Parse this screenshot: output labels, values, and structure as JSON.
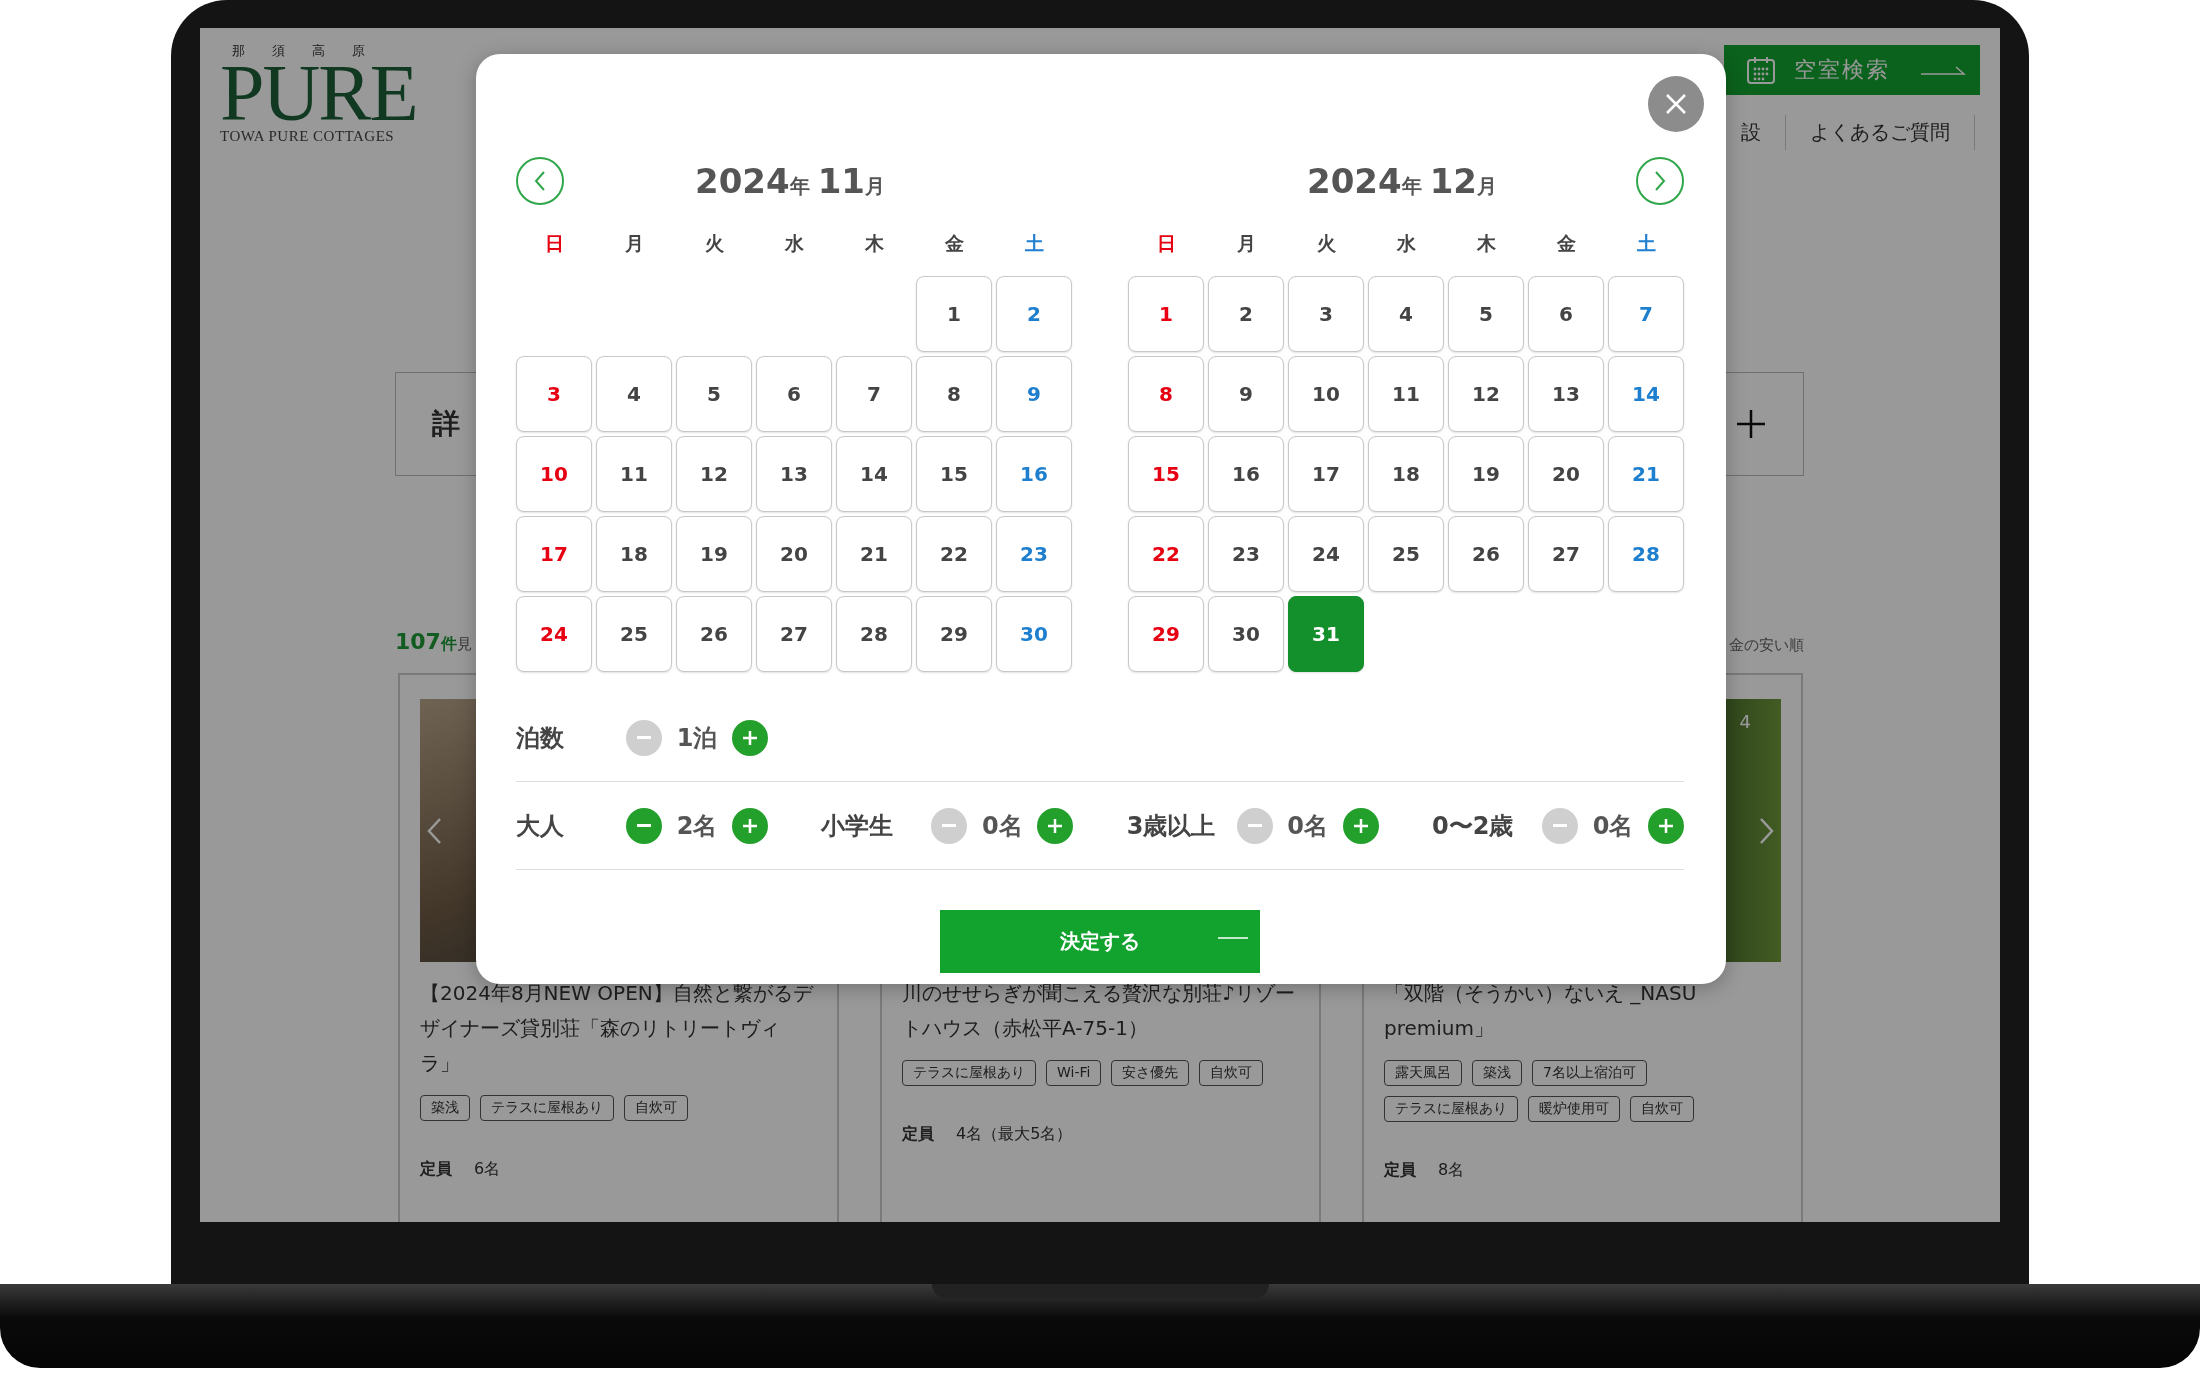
{
  "logo": {
    "subtitle": "那須高原",
    "wordmark": "PURE",
    "tagline": "TOWA PURE COTTAGES"
  },
  "search_button": {
    "label": "空室検索"
  },
  "nav": [
    "設",
    "よくあるご質問"
  ],
  "detail_panel": {
    "label": "詳"
  },
  "results": {
    "count": "107",
    "count_unit": "件",
    "text": "見",
    "sort": "金の安い順"
  },
  "cards": [
    {
      "kind": "room",
      "prev_arrow": true,
      "next_arrow": false,
      "title": "【2024年8月NEW OPEN】自然と繋がるデザイナーズ貸別荘「森のリトリートヴィラ」",
      "tags": [
        "築浅",
        "テラスに屋根あり",
        "自炊可"
      ],
      "capacity_label": "定員",
      "capacity": "6名"
    },
    {
      "kind": "room",
      "title": "川のせせらぎが聞こえる贅沢な別荘♪リゾートハウス（赤松平A-75-1）",
      "tags": [
        "テラスに屋根あり",
        "Wi-Fi",
        "安さ優先",
        "自炊可"
      ],
      "capacity_label": "定員",
      "capacity": "4名（最大5名）"
    },
    {
      "kind": "forest",
      "prev_arrow": false,
      "next_arrow": true,
      "photo_counter": "4",
      "title": "「双階（そうかい）ないえ _NASU premium」",
      "tags": [
        "露天風呂",
        "築浅",
        "7名以上宿泊可",
        "テラスに屋根あり",
        "暖炉使用可",
        "自炊可"
      ],
      "capacity_label": "定員",
      "capacity": "8名"
    }
  ],
  "modal": {
    "calendars": [
      {
        "kind": "prev",
        "year": "2024",
        "year_unit": "年",
        "month": "11",
        "month_unit": "月",
        "weekdays": [
          {
            "label": "日",
            "kind": "sunday"
          },
          {
            "label": "月",
            "kind": "weekday"
          },
          {
            "label": "火",
            "kind": "weekday"
          },
          {
            "label": "水",
            "kind": "weekday"
          },
          {
            "label": "木",
            "kind": "weekday"
          },
          {
            "label": "金",
            "kind": "weekday"
          },
          {
            "label": "土",
            "kind": "saturday"
          }
        ],
        "weeks": [
          [
            {
              "day": "1",
              "selected": false
            },
            {
              "day": "2",
              "selected": false
            }
          ],
          [
            {
              "day": "3",
              "selected": false
            },
            {
              "day": "4",
              "selected": false
            },
            {
              "day": "5",
              "selected": false
            },
            {
              "day": "6",
              "selected": false
            },
            {
              "day": "7",
              "selected": false
            },
            {
              "day": "8",
              "selected": false
            },
            {
              "day": "9",
              "selected": false
            }
          ],
          [
            {
              "day": "10",
              "selected": false
            },
            {
              "day": "11",
              "selected": false
            },
            {
              "day": "12",
              "selected": false
            },
            {
              "day": "13",
              "selected": false
            },
            {
              "day": "14",
              "selected": false
            },
            {
              "day": "15",
              "selected": false
            },
            {
              "day": "16",
              "selected": false
            }
          ],
          [
            {
              "day": "17",
              "selected": false
            },
            {
              "day": "18",
              "selected": false
            },
            {
              "day": "19",
              "selected": false
            },
            {
              "day": "20",
              "selected": false
            },
            {
              "day": "21",
              "selected": false
            },
            {
              "day": "22",
              "selected": false
            },
            {
              "day": "23",
              "selected": false
            }
          ],
          [
            {
              "day": "24",
              "selected": false
            },
            {
              "day": "25",
              "selected": false
            },
            {
              "day": "26",
              "selected": false
            },
            {
              "day": "27",
              "selected": false
            },
            {
              "day": "28",
              "selected": false
            },
            {
              "day": "29",
              "selected": false
            },
            {
              "day": "30",
              "selected": false
            }
          ]
        ]
      },
      {
        "kind": "next",
        "year": "2024",
        "year_unit": "年",
        "month": "12",
        "month_unit": "月",
        "weekdays": [
          {
            "label": "日",
            "kind": "sunday"
          },
          {
            "label": "月",
            "kind": "weekday"
          },
          {
            "label": "火",
            "kind": "weekday"
          },
          {
            "label": "水",
            "kind": "weekday"
          },
          {
            "label": "木",
            "kind": "weekday"
          },
          {
            "label": "金",
            "kind": "weekday"
          },
          {
            "label": "土",
            "kind": "saturday"
          }
        ],
        "weeks": [
          [
            {
              "day": "1",
              "selected": false
            },
            {
              "day": "2",
              "selected": false
            },
            {
              "day": "3",
              "selected": false
            },
            {
              "day": "4",
              "selected": false
            },
            {
              "day": "5",
              "selected": false
            },
            {
              "day": "6",
              "selected": false
            },
            {
              "day": "7",
              "selected": false
            }
          ],
          [
            {
              "day": "8",
              "selected": false
            },
            {
              "day": "9",
              "selected": false
            },
            {
              "day": "10",
              "selected": false
            },
            {
              "day": "11",
              "selected": false
            },
            {
              "day": "12",
              "selected": false
            },
            {
              "day": "13",
              "selected": false
            },
            {
              "day": "14",
              "selected": false
            }
          ],
          [
            {
              "day": "15",
              "selected": false
            },
            {
              "day": "16",
              "selected": false
            },
            {
              "day": "17",
              "selected": false
            },
            {
              "day": "18",
              "selected": false
            },
            {
              "day": "19",
              "selected": false
            },
            {
              "day": "20",
              "selected": false
            },
            {
              "day": "21",
              "selected": false
            }
          ],
          [
            {
              "day": "22",
              "selected": false
            },
            {
              "day": "23",
              "selected": false
            },
            {
              "day": "24",
              "selected": false
            },
            {
              "day": "25",
              "selected": false
            },
            {
              "day": "26",
              "selected": false
            },
            {
              "day": "27",
              "selected": false
            },
            {
              "day": "28",
              "selected": false
            }
          ],
          [
            {
              "day": "29",
              "selected": false
            },
            {
              "day": "30",
              "selected": false
            },
            {
              "day": "31",
              "selected": true
            }
          ]
        ]
      }
    ],
    "counter_rows": [
      [
        {
          "label": "泊数",
          "value": "1泊",
          "minus_disabled": true,
          "plus_disabled": false
        }
      ],
      [
        {
          "label": "大人",
          "value": "2名",
          "minus_disabled": false,
          "plus_disabled": false
        },
        {
          "label": "小学生",
          "value": "0名",
          "minus_disabled": true,
          "plus_disabled": false
        },
        {
          "label": "3歳以上",
          "value": "0名",
          "minus_disabled": true,
          "plus_disabled": false
        },
        {
          "label": "0〜2歳",
          "value": "0名",
          "minus_disabled": true,
          "plus_disabled": false
        }
      ]
    ],
    "confirm_button": "決定する"
  }
}
